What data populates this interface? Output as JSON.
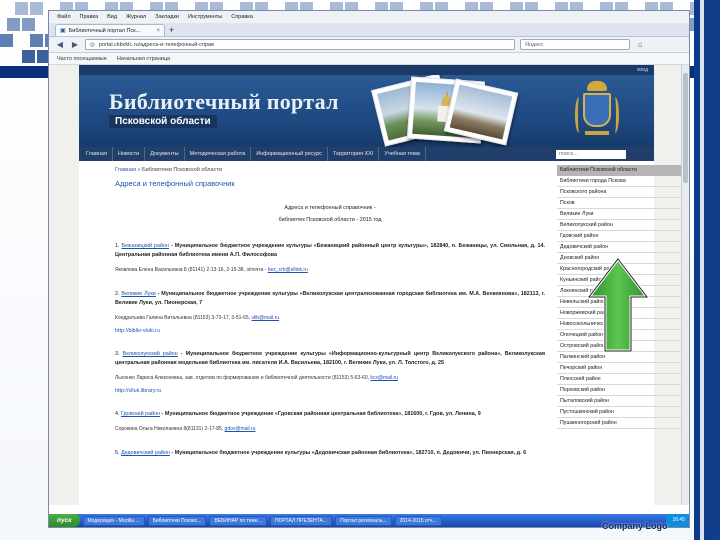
{
  "browser": {
    "menu": [
      "Файл",
      "Правка",
      "Вид",
      "Журнал",
      "Закладки",
      "Инструменты",
      "Справка"
    ],
    "tab_title": "Библиотечный портал Пск...",
    "tab_close": "×",
    "new_tab": "+",
    "url": "portal.ckbvklc.ru/адреса-и-телефонный-справ",
    "search_placeholder": "Яндекс",
    "nav_back": "◀",
    "nav_forward": "▶",
    "nav_home": "⌂",
    "bookmarks": [
      "Часто посещаемые",
      "Начальная страница"
    ]
  },
  "site": {
    "top_link": "вход",
    "title": "Библиотечный портал",
    "subtitle": "Псковской области",
    "menu": [
      "Главная",
      "Новости",
      "Документы",
      "Методическая работа",
      "Информационный ресурс",
      "Территория XXI",
      "Учебная тема"
    ],
    "search_placeholder": "поиск...",
    "breadcrumb_home": "Главная",
    "breadcrumb_rest": " » Библиотеки Псковской области",
    "heading": "Адреса и телефонный справочник",
    "doc_title_line1": "Адреса и телефонный справочник -",
    "doc_title_line2": "библиотек Псковской области - 2015 год",
    "entries": [
      {
        "num": "1.",
        "name": "Бежаницкий район",
        "text": " - Муниципальное бюджетное учреждение культуры «Бежаницкий районный центр культуры», 182840, п. Бежаницы, ул. Смольная, д. 14. Центральная районная библиотека имени А.П. Философова",
        "sub": "Яковлева Елена Васильевна 8 (81141) 2-13-16, 2-15-38, э/почта - ",
        "sub_link": "bez_crb@ellink.ru",
        "url": ""
      },
      {
        "num": "2.",
        "name": "Великие Луки",
        "text": " - Муниципальное бюджетное учреждение культуры «Великолукская централизованная городская библиотека им. М.А. Венкевнова», 182113, г. Великие Луки, ул. Пионерская, 7",
        "sub": "Кондратьева Галина Витальевна (81153) 3-73-17, 3-51-65, ",
        "sub_link": "vlib@mail.ru",
        "url": "http://biblio-vluki.ru"
      },
      {
        "num": "3.",
        "name": "Великолукский район",
        "text": " - Муниципальное бюджетное учреждение культуры «Информационно-культурный центр Великолукского района», Великолукская центральная районная модельная библиотека им. писателя И.А. Васильева, 182100, г. Великие Луки, ул. Л. Толстого, д. 25",
        "sub": "Лысенко Лариса Алексеевна, зав. отделом по формированию и библиотечной деятельности (81153) 5-63-60, ",
        "sub_link": "kcs@mail.ru",
        "url": "http://vlluk.library.ru"
      },
      {
        "num": "4.",
        "name": "Гдовский район",
        "text": " - Муниципальное бюджетное учреждение «Гдовская районная центральная библиотека», 181600, г. Гдов, ул. Ленина, 9",
        "sub": "Сорокина Ольга Николаевна 8(81131) 2-17-85, ",
        "sub_link": "gdov@mail.ru",
        "url": ""
      },
      {
        "num": "5.",
        "name": "Дедовичский район",
        "text": " - Муниципальное бюджетное учреждение культуры «Дедовичская районная библиотека», 182710, п. Дедовичи, ул. Пионерская, д. 6",
        "sub": "",
        "sub_link": "",
        "url": ""
      }
    ],
    "sidebar_head": "Библиотеки Псковской области",
    "sidebar": [
      "Библиотеки города Пскова",
      "Псковского района",
      "Псков",
      "Великие Луки",
      "Великолукский район",
      "Гдовский район",
      "Дедовичский район",
      "Дновский район",
      "Красногородский район",
      "Куньинский район",
      "Локнянский район",
      "Невельский район",
      "Новоржевский район",
      "Новосокольнический район",
      "Опочецкий район",
      "Островский район",
      "Палкинский район",
      "Печорский район",
      "Плюсский район",
      "Порховский район",
      "Пыталовский район",
      "Пустошкинский район",
      "Пушкиногорский район"
    ]
  },
  "taskbar": {
    "start": "пуск",
    "items": [
      "Модерация - Mozilla ...",
      "Библиотеки Псковс...",
      "ВЕБИНАР по теме...",
      "ПОРТАЛ ПРЕЗЕНТА...",
      "Портал региональ...",
      "2014-2015 отч..."
    ],
    "clock": "16:45"
  },
  "slide": {
    "company_logo": "Company Logo"
  },
  "colors": {
    "banner": "#1f4a82",
    "menu": "#223f6b",
    "link": "#1a55b0",
    "arrow": "#3aa835",
    "taskbar": "#245ac8"
  }
}
